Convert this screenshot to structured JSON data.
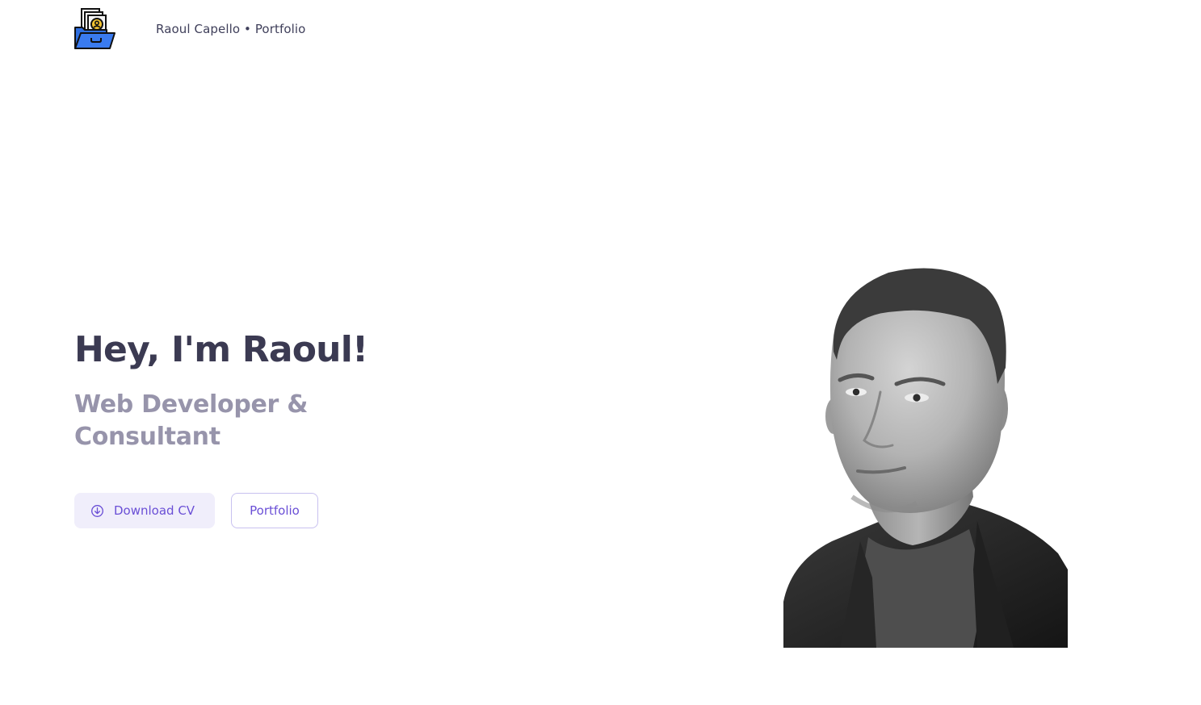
{
  "header": {
    "logo_icon": "portfolio-folder-icon",
    "site_title": "Raoul Capello • Portfolio"
  },
  "hero": {
    "heading": "Hey, I'm Raoul!",
    "subheading": "Web Developer & Consultant",
    "buttons": {
      "download_cv": {
        "label": "Download CV",
        "icon": "download-circle-icon"
      },
      "portfolio": {
        "label": "Portfolio"
      }
    },
    "portrait_alt": "Portrait of Raoul"
  },
  "colors": {
    "heading": "#3b3a52",
    "subheading": "#9794ab",
    "accent": "#6a4fd6",
    "accent_bg": "#f0eefb",
    "logo_blue": "#2f6fe0",
    "logo_yellow": "#f2c230"
  }
}
